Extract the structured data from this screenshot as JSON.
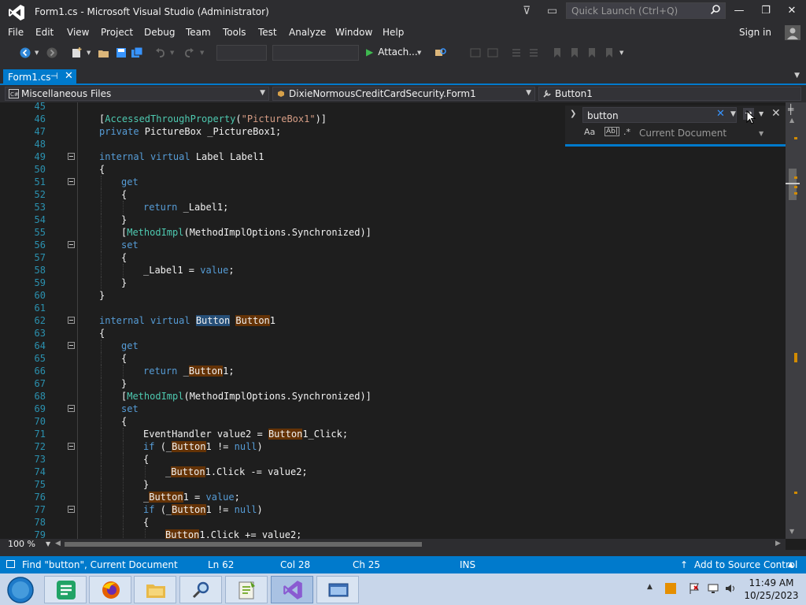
{
  "window": {
    "title": "Form1.cs - Microsoft Visual Studio  (Administrator)",
    "quick_launch_placeholder": "Quick Launch (Ctrl+Q)",
    "minimize": "—",
    "restore": "❐",
    "close": "✕"
  },
  "menu": {
    "items": [
      "File",
      "Edit",
      "View",
      "Project",
      "Debug",
      "Team",
      "Tools",
      "Test",
      "Analyze",
      "Window",
      "Help"
    ],
    "sign_in": "Sign in"
  },
  "toolbar": {
    "attach_label": "Attach...",
    "attach_play": "▶"
  },
  "tabs": {
    "active": "Form1.cs",
    "pin": "⊣",
    "close": "✕"
  },
  "navbar": {
    "project": "Miscellaneous Files",
    "type": "DixieNormousCreditCardSecurity.Form1",
    "member": "Button1"
  },
  "find": {
    "query": "button",
    "clear": "✕",
    "next": "→",
    "close": "✕",
    "scope": "Current Document",
    "opt_case": "Aa",
    "opt_word": "Ab|",
    "opt_regex": ".*"
  },
  "editor": {
    "zoom": "100 %",
    "lines": [
      {
        "n": "45",
        "fold": false,
        "indent": 0,
        "html": ""
      },
      {
        "n": "46",
        "fold": false,
        "indent": 0,
        "tokens": [
          [
            "",
            "["
          ],
          [
            "ar",
            "AccessedThroughProperty"
          ],
          [
            "",
            "("
          ],
          [
            "st",
            "\"PictureBox1\""
          ],
          [
            "",
            ")]"
          ]
        ]
      },
      {
        "n": "47",
        "fold": false,
        "indent": 0,
        "tokens": [
          [
            "kw",
            "private "
          ],
          [
            "",
            "PictureBox _PictureBox1;"
          ]
        ]
      },
      {
        "n": "48",
        "fold": false,
        "indent": 0,
        "tokens": []
      },
      {
        "n": "49",
        "fold": true,
        "indent": 0,
        "tokens": [
          [
            "kw",
            "internal virtual "
          ],
          [
            "",
            "Label Label1"
          ]
        ]
      },
      {
        "n": "50",
        "fold": false,
        "indent": 0,
        "tokens": [
          [
            "",
            "{"
          ]
        ]
      },
      {
        "n": "51",
        "fold": true,
        "indent": 1,
        "tokens": [
          [
            "kw",
            "get"
          ]
        ]
      },
      {
        "n": "52",
        "fold": false,
        "indent": 1,
        "tokens": [
          [
            "",
            "{"
          ]
        ]
      },
      {
        "n": "53",
        "fold": false,
        "indent": 2,
        "tokens": [
          [
            "kw",
            "return "
          ],
          [
            "",
            "_Label1;"
          ]
        ]
      },
      {
        "n": "54",
        "fold": false,
        "indent": 1,
        "tokens": [
          [
            "",
            "}"
          ]
        ]
      },
      {
        "n": "55",
        "fold": false,
        "indent": 1,
        "tokens": [
          [
            "",
            "["
          ],
          [
            "ar",
            "MethodImpl"
          ],
          [
            "",
            "(MethodImplOptions.Synchronized)]"
          ]
        ]
      },
      {
        "n": "56",
        "fold": true,
        "indent": 1,
        "tokens": [
          [
            "kw",
            "set"
          ]
        ]
      },
      {
        "n": "57",
        "fold": false,
        "indent": 1,
        "tokens": [
          [
            "",
            "{"
          ]
        ]
      },
      {
        "n": "58",
        "fold": false,
        "indent": 2,
        "tokens": [
          [
            "",
            "_Label1 = "
          ],
          [
            "kw",
            "value"
          ],
          [
            "",
            ";"
          ]
        ]
      },
      {
        "n": "59",
        "fold": false,
        "indent": 1,
        "tokens": [
          [
            "",
            "}"
          ]
        ]
      },
      {
        "n": "60",
        "fold": false,
        "indent": 0,
        "tokens": [
          [
            "",
            "}"
          ]
        ]
      },
      {
        "n": "61",
        "fold": false,
        "indent": 0,
        "tokens": []
      },
      {
        "n": "62",
        "fold": true,
        "indent": 0,
        "tokens": [
          [
            "kw",
            "internal virtual "
          ],
          [
            "hlsel",
            "Button"
          ],
          [
            "",
            " "
          ],
          [
            "hl",
            "Button"
          ],
          [
            "",
            "1"
          ]
        ]
      },
      {
        "n": "63",
        "fold": false,
        "indent": 0,
        "tokens": [
          [
            "",
            "{"
          ]
        ]
      },
      {
        "n": "64",
        "fold": true,
        "indent": 1,
        "tokens": [
          [
            "kw",
            "get"
          ]
        ]
      },
      {
        "n": "65",
        "fold": false,
        "indent": 1,
        "tokens": [
          [
            "",
            "{"
          ]
        ]
      },
      {
        "n": "66",
        "fold": false,
        "indent": 2,
        "tokens": [
          [
            "kw",
            "return "
          ],
          [
            "",
            "_"
          ],
          [
            "hl",
            "Button"
          ],
          [
            "",
            "1;"
          ]
        ]
      },
      {
        "n": "67",
        "fold": false,
        "indent": 1,
        "tokens": [
          [
            "",
            "}"
          ]
        ]
      },
      {
        "n": "68",
        "fold": false,
        "indent": 1,
        "tokens": [
          [
            "",
            "["
          ],
          [
            "ar",
            "MethodImpl"
          ],
          [
            "",
            "(MethodImplOptions.Synchronized)]"
          ]
        ]
      },
      {
        "n": "69",
        "fold": true,
        "indent": 1,
        "tokens": [
          [
            "kw",
            "set"
          ]
        ]
      },
      {
        "n": "70",
        "fold": false,
        "indent": 1,
        "tokens": [
          [
            "",
            "{"
          ]
        ]
      },
      {
        "n": "71",
        "fold": false,
        "indent": 2,
        "tokens": [
          [
            "",
            "EventHandler value2 = "
          ],
          [
            "hl",
            "Button"
          ],
          [
            "",
            "1_Click;"
          ]
        ]
      },
      {
        "n": "72",
        "fold": true,
        "indent": 2,
        "tokens": [
          [
            "kw",
            "if "
          ],
          [
            "",
            "(_"
          ],
          [
            "hl",
            "Button"
          ],
          [
            "",
            "1 != "
          ],
          [
            "kw",
            "null"
          ],
          [
            "",
            ")"
          ]
        ]
      },
      {
        "n": "73",
        "fold": false,
        "indent": 2,
        "tokens": [
          [
            "",
            "{"
          ]
        ]
      },
      {
        "n": "74",
        "fold": false,
        "indent": 3,
        "tokens": [
          [
            "",
            "_"
          ],
          [
            "hl",
            "Button"
          ],
          [
            "",
            "1.Click -= value2;"
          ]
        ]
      },
      {
        "n": "75",
        "fold": false,
        "indent": 2,
        "tokens": [
          [
            "",
            "}"
          ]
        ]
      },
      {
        "n": "76",
        "fold": false,
        "indent": 2,
        "tokens": [
          [
            "",
            "_"
          ],
          [
            "hl",
            "Button"
          ],
          [
            "",
            "1 = "
          ],
          [
            "kw",
            "value"
          ],
          [
            "",
            ";"
          ]
        ]
      },
      {
        "n": "77",
        "fold": true,
        "indent": 2,
        "tokens": [
          [
            "kw",
            "if "
          ],
          [
            "",
            "(_"
          ],
          [
            "hl",
            "Button"
          ],
          [
            "",
            "1 != "
          ],
          [
            "kw",
            "null"
          ],
          [
            "",
            ")"
          ]
        ]
      },
      {
        "n": "78",
        "fold": false,
        "indent": 2,
        "tokens": [
          [
            "",
            "{"
          ]
        ]
      },
      {
        "n": "79",
        "fold": false,
        "indent": 3,
        "tokens": [
          [
            "hl",
            "Button"
          ],
          [
            "",
            "1.Click += value2;"
          ]
        ]
      }
    ]
  },
  "status": {
    "message": "Find \"button\", Current Document",
    "ln": "Ln 62",
    "col": "Col 28",
    "ch": "Ch 25",
    "mode": "INS",
    "source_control": "Add to Source Control"
  },
  "taskbar": {
    "time": "11:49 AM",
    "date": "10/25/2023"
  },
  "colors": {
    "accent": "#007acc",
    "highlight": "#653306",
    "keyword": "#569cd6",
    "type": "#4ec9b0",
    "string": "#d69d85",
    "line_number": "#2b91af"
  }
}
